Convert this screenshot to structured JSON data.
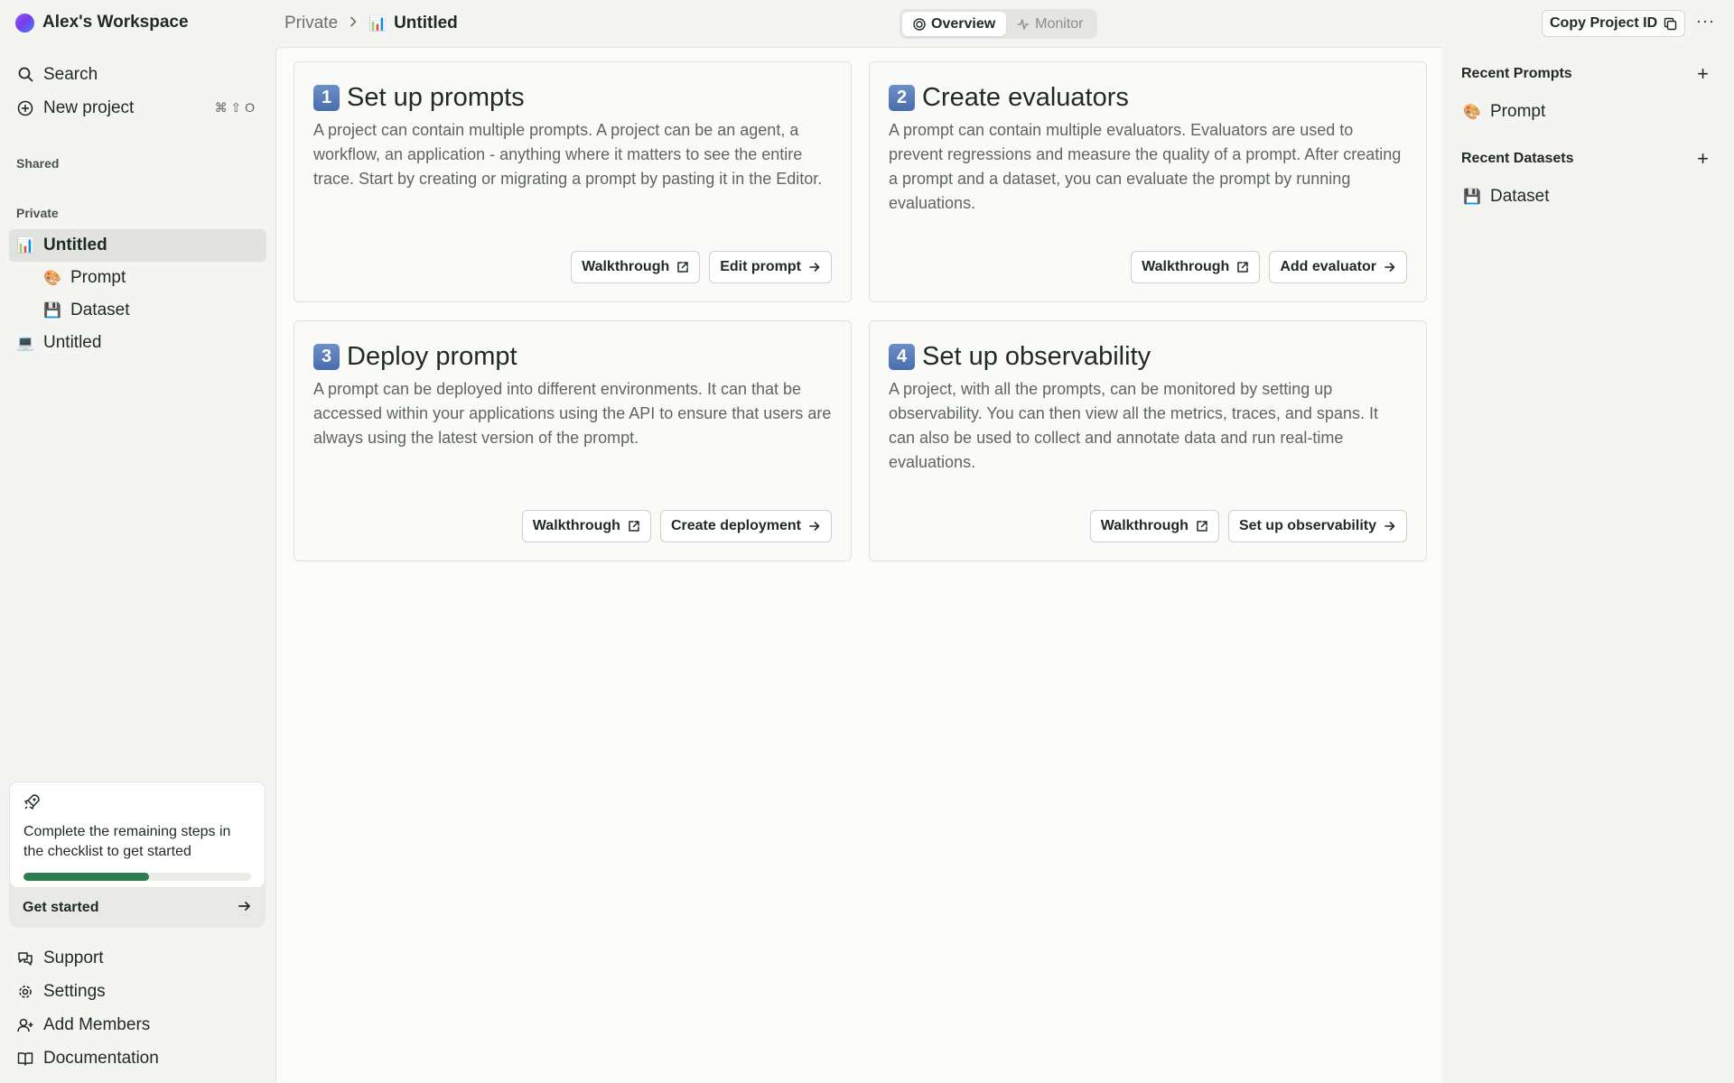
{
  "workspace": {
    "name": "Alex's Workspace"
  },
  "nav": {
    "search": "Search",
    "new_project": "New project",
    "new_project_shortcut": "⌘ ⇧ O"
  },
  "sections": {
    "shared": "Shared",
    "private": "Private"
  },
  "projects": [
    {
      "label": "Untitled",
      "icon": "bar-chart-emoji",
      "glyph": "📊"
    },
    {
      "label": "Prompt",
      "icon": "palette-emoji",
      "glyph": "🎨"
    },
    {
      "label": "Dataset",
      "icon": "floppy-disk-emoji",
      "glyph": "💾"
    },
    {
      "label": "Untitled",
      "icon": "laptop-emoji",
      "glyph": "💻"
    }
  ],
  "getting_started": {
    "text": "Complete the remaining steps in the checklist to get started",
    "progress": 0.55,
    "cta": "Get started"
  },
  "bottom_nav": {
    "support": "Support",
    "settings": "Settings",
    "add_members": "Add Members",
    "documentation": "Documentation"
  },
  "breadcrumb": {
    "root": "Private",
    "current": "Untitled",
    "current_glyph": "📊"
  },
  "view_tabs": {
    "overview": "Overview",
    "monitor": "Monitor"
  },
  "header": {
    "copy_label": "Copy Project ID",
    "more": "···"
  },
  "cards": [
    {
      "num": "1",
      "title": "Set up prompts",
      "desc": "A project can contain multiple prompts. A project can be an agent, a workflow, an application - anything where it matters to see the entire trace. Start by creating or migrating a prompt by pasting it in the Editor.",
      "walkthrough": "Walkthrough",
      "action": "Edit prompt"
    },
    {
      "num": "2",
      "title": "Create evaluators",
      "desc": "A prompt can contain multiple evaluators. Evaluators are used to prevent regressions and measure the quality of a prompt. After creating a prompt and a dataset, you can evaluate the prompt by running evaluations.",
      "walkthrough": "Walkthrough",
      "action": "Add evaluator"
    },
    {
      "num": "3",
      "title": "Deploy prompt",
      "desc": "A prompt can be deployed into different environments. It can that be accessed within your applications using the API to ensure that users are always using the latest version of the prompt.",
      "walkthrough": "Walkthrough",
      "action": "Create deployment"
    },
    {
      "num": "4",
      "title": "Set up observability",
      "desc": "A project, with all the prompts, can be monitored by setting up observability. You can then view all the metrics, traces, and spans. It can also be used to collect and annotate data and run real-time evaluations.",
      "walkthrough": "Walkthrough",
      "action": "Set up observability"
    }
  ],
  "right_panel": {
    "recent_prompts": "Recent Prompts",
    "recent_datasets": "Recent Datasets",
    "prompt_item": "Prompt",
    "prompt_glyph": "🎨",
    "dataset_item": "Dataset",
    "dataset_glyph": "💾",
    "plus": "+"
  },
  "colors": {
    "accent_green": "#2e7d4f",
    "badge_blue": "#5a7fbf"
  }
}
